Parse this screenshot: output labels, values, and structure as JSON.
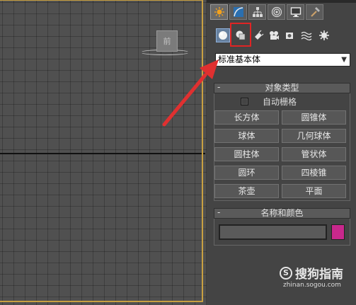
{
  "viewport": {
    "viewcube_label": "前"
  },
  "command_panel": {
    "tabs": [
      {
        "icon": "sun-create-icon"
      },
      {
        "icon": "modify-curve-icon"
      },
      {
        "icon": "hierarchy-icon"
      },
      {
        "icon": "motion-icon"
      },
      {
        "icon": "display-monitor-icon"
      },
      {
        "icon": "utilities-hammer-icon"
      }
    ],
    "subcategories": [
      {
        "icon": "geometry-sphere-icon"
      },
      {
        "icon": "shapes-icon"
      },
      {
        "icon": "lights-icon"
      },
      {
        "icon": "cameras-icon"
      },
      {
        "icon": "helpers-icon"
      },
      {
        "icon": "spacewarps-icon"
      },
      {
        "icon": "systems-icon"
      }
    ],
    "dropdown_value": "标准基本体",
    "object_type": {
      "title": "对象类型",
      "collapse_symbol": "-",
      "autogrid_label": "自动栅格",
      "buttons": [
        "长方体",
        "圆锥体",
        "球体",
        "几何球体",
        "圆柱体",
        "管状体",
        "圆环",
        "四棱锥",
        "茶壶",
        "平面"
      ]
    },
    "name_color": {
      "title": "名称和颜色",
      "collapse_symbol": "-",
      "name_value": "",
      "color": "#c8288c"
    }
  },
  "watermark": {
    "brand": "搜狗指南",
    "url": "zhinan.sogou.com"
  },
  "annotation": {
    "arrow_color": "#e03030",
    "highlight_color": "#e02424"
  }
}
